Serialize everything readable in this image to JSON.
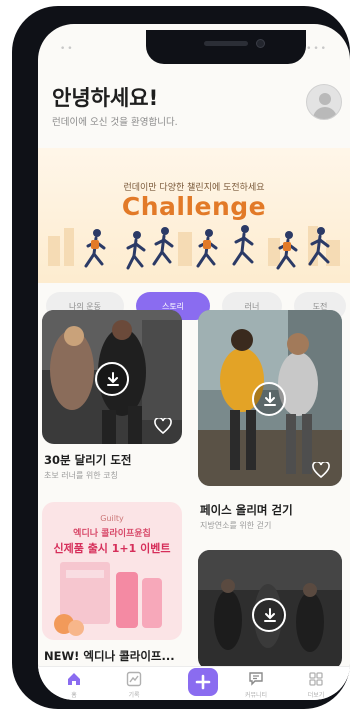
{
  "colors": {
    "accent": "#8a6cf0",
    "challenge_orange": "#e27a28",
    "banner_bg": "#fdeccf",
    "device_frame": "#0f1117"
  },
  "status_bar": {
    "left": "••",
    "right": "•••"
  },
  "header": {
    "greeting": "안녕하세요!",
    "subtitle": "런데이에 오신 것을 환영합니다."
  },
  "banner": {
    "subtitle": "런데이만 다양한 챌린지에 도전하세요",
    "title": "Challenge"
  },
  "filter_tabs": [
    {
      "label": "나의 운동",
      "active": false
    },
    {
      "label": "스토리",
      "active": true
    },
    {
      "label": "러너",
      "active": false
    },
    {
      "label": "도전",
      "active": false
    }
  ],
  "cards": [
    {
      "title": "30분 달리기 도전",
      "subtitle": "초보 러너를 위한 코칭",
      "icon": "download-icon",
      "liked": false
    },
    {
      "title": "페이스 올리며 걷기",
      "subtitle": "지방연소를 위한 걷기",
      "icon": "download-icon",
      "liked": false
    },
    {
      "title": "NEW! 엑디나 콜라이프...",
      "ad_brand": "Guilty",
      "ad_line1": "엑디나 콜라이프윤칩",
      "ad_line2": "신제품 출시 1+1 이벤트"
    },
    {
      "title": "",
      "icon": "download-icon"
    }
  ],
  "bottom_nav": [
    {
      "label": "홈",
      "icon": "home-icon",
      "active": true
    },
    {
      "label": "기록",
      "icon": "chart-icon",
      "active": false
    },
    {
      "label": "",
      "icon": "plus-icon",
      "active": false
    },
    {
      "label": "커뮤니티",
      "icon": "chat-icon",
      "active": false
    },
    {
      "label": "더보기",
      "icon": "grid-icon",
      "active": false
    }
  ]
}
